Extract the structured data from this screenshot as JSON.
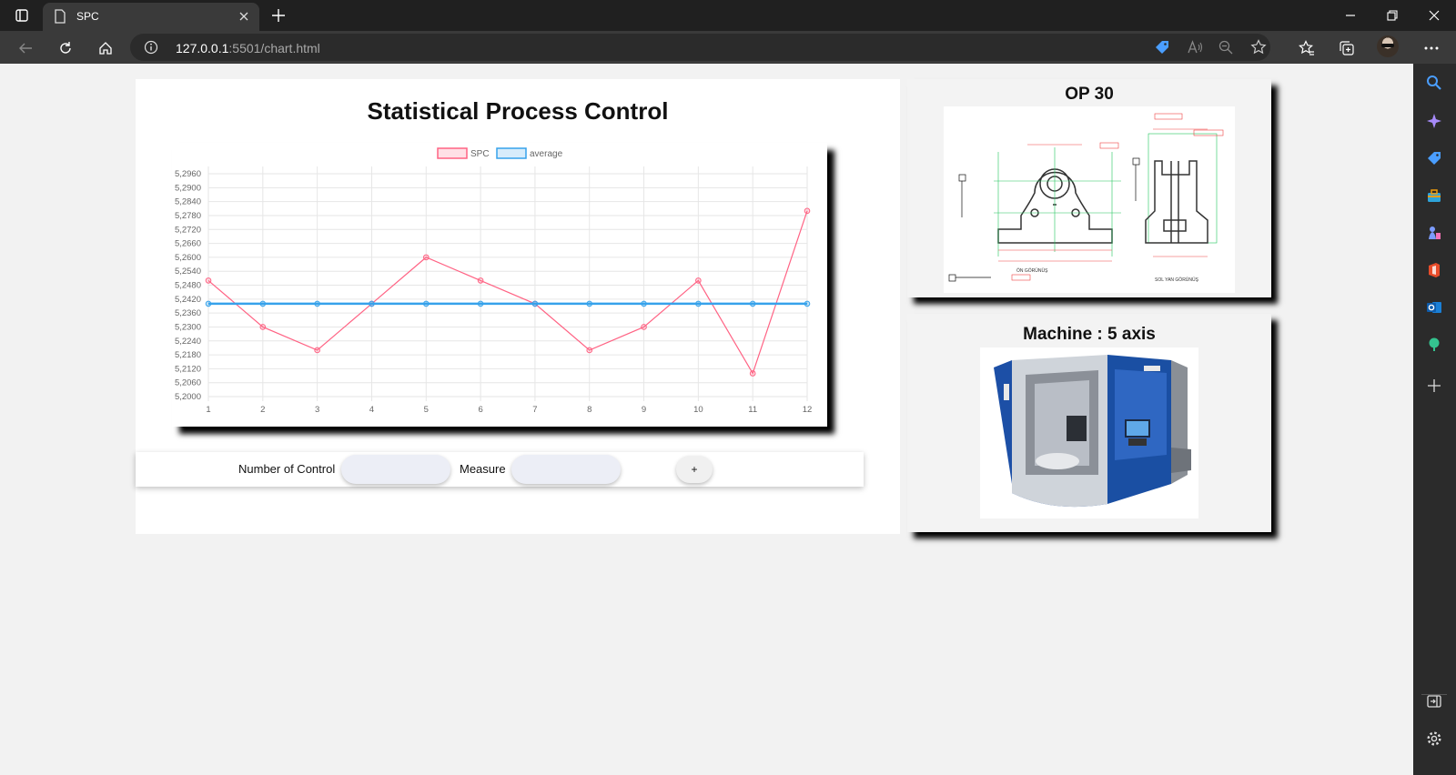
{
  "browser": {
    "tab_title": "SPC",
    "url_host": "127.0.0.1",
    "url_rest": ":5501/chart.html"
  },
  "page": {
    "title": "Statistical Process Control",
    "form": {
      "number_label": "Number of Control",
      "measure_label": "Measure",
      "add_label": "+",
      "number_value": "",
      "measure_value": ""
    },
    "op_card_title": "OP 30",
    "machine_card_title": "Machine : 5 axis"
  },
  "drawing_labels": {
    "front_view": "ÖN GÖRÜNÜŞ",
    "side_view": "SOL YAN GÖRÜNÜŞ"
  },
  "chart_data": {
    "type": "line",
    "categories": [
      "1",
      "2",
      "3",
      "4",
      "5",
      "6",
      "7",
      "8",
      "9",
      "10",
      "11",
      "12"
    ],
    "series": [
      {
        "name": "SPC",
        "color": "#ff6384",
        "values": [
          5.25,
          5.23,
          5.22,
          5.24,
          5.26,
          5.25,
          5.24,
          5.22,
          5.23,
          5.25,
          5.21,
          5.28
        ]
      },
      {
        "name": "average",
        "color": "#36a2eb",
        "values": [
          5.24,
          5.24,
          5.24,
          5.24,
          5.24,
          5.24,
          5.24,
          5.24,
          5.24,
          5.24,
          5.24,
          5.24
        ]
      }
    ],
    "y_ticks": [
      "5,2960",
      "5,2900",
      "5,2840",
      "5,2780",
      "5,2720",
      "5,2660",
      "5,2600",
      "5,2540",
      "5,2480",
      "5,2420",
      "5,2360",
      "5,2300",
      "5,2240",
      "5,2180",
      "5,2120",
      "5,2060",
      "5,2000"
    ],
    "ylim": [
      5.2,
      5.296
    ],
    "legend_position": "top",
    "grid": true
  }
}
